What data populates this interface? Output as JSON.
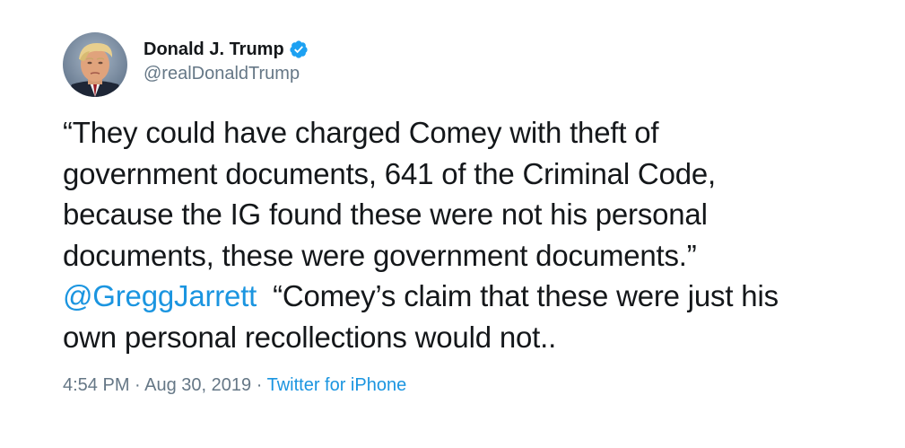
{
  "author": {
    "display_name": "Donald J. Trump",
    "handle": "@realDonaldTrump",
    "verified": true
  },
  "tweet": {
    "lines": [
      "“They could have charged Comey with theft of",
      "government documents, 641 of the Criminal Code,",
      "because the IG found these were not his personal",
      "documents, these were government documents.”"
    ],
    "mention": "@GreggJarrett",
    "after_mention": "  “Comey’s claim that these were just his",
    "last_line": "own personal recollections would not.."
  },
  "meta": {
    "time": "4:54 PM",
    "separator": " · ",
    "date": "Aug 30, 2019",
    "source": "Twitter for iPhone"
  },
  "colors": {
    "link": "#1b95e0",
    "text": "#14171a",
    "muted": "#657786",
    "verified_badge": "#1da1f2"
  },
  "icons": {
    "verified": "verified-badge-icon"
  }
}
